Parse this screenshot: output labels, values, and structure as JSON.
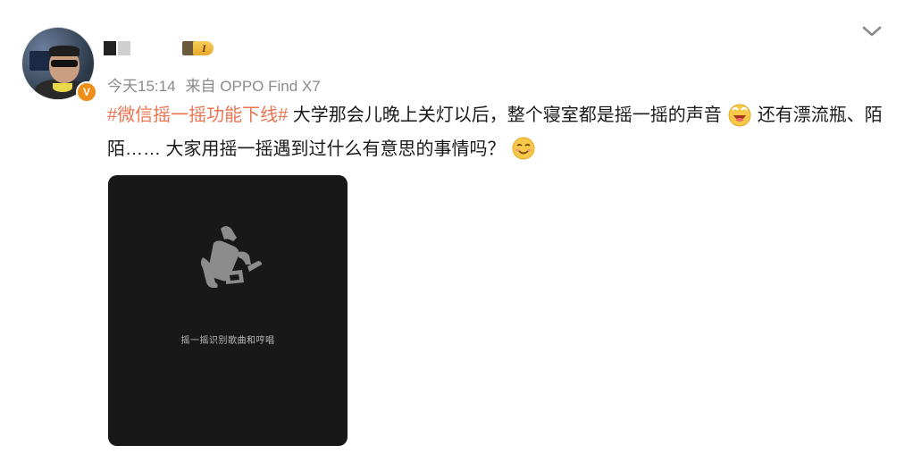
{
  "post": {
    "user_badge": "V",
    "level_label": "I",
    "time": "今天15:14",
    "source": "来自 OPPO Find X7",
    "topic": "#微信摇一摇功能下线#",
    "text_part1": " 大学那会儿晚上关灯以后，整个寝室都是摇一摇的声音",
    "text_part2": "还有漂流瓶、陌陌…… 大家用摇一摇遇到过什么有意思的事情吗？",
    "emoji1": "grinning-face-emoji",
    "emoji2": "smiling-face-emoji",
    "expand_icon": "chevron-down-icon"
  },
  "media": {
    "caption": "摇一摇识别歌曲和哼唱",
    "icon": "shake-hand-icon",
    "background": "#181818"
  },
  "colors": {
    "topic": "#eb7350",
    "meta": "#8a8a8a",
    "badge": "#f08e1a"
  }
}
